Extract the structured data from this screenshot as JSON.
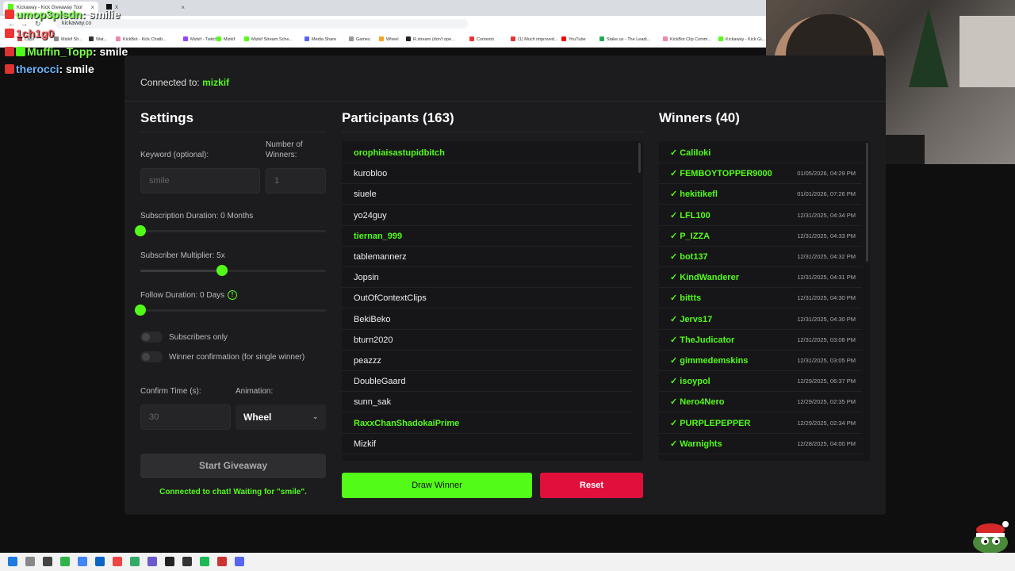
{
  "browser": {
    "tabs": [
      {
        "label": "Kickaway - Kick Giveaway Tool"
      },
      {
        "label": "X"
      }
    ],
    "url": "kickaway.co",
    "bookmarks": [
      "Clips",
      "Mizkif Sh...",
      "Wat...",
      "KickBot - Kick Chatb...",
      "Mizkif - Twitch",
      "Mizkif",
      "Mizkif Stream Sche...",
      "Media Share",
      "Games",
      "Wheel",
      "R.stream (don't ope...",
      "Contexto",
      "(1) Much improved...",
      "YouTube",
      "Stake.us - The Leadi...",
      "KickBot Clip Comm...",
      "Kickaway - Kick Gi..."
    ]
  },
  "chat": [
    {
      "user": "umop3plsdn",
      "message": "smilie"
    },
    {
      "user": "1ch1g0",
      "message": ""
    },
    {
      "user": "Muffin_Topp",
      "message": "smile"
    },
    {
      "user": "therocci",
      "message": "smile"
    }
  ],
  "header": {
    "connected_label": "Connected to:",
    "channel": "mizkif"
  },
  "settings": {
    "title": "Settings",
    "keyword_label": "Keyword (optional):",
    "keyword_value": "smile",
    "winners_label_1": "Number of",
    "winners_label_2": "Winners:",
    "winners_value": "1",
    "sub_duration_label": "Subscription Duration: 0 Months",
    "sub_duration_fraction": 0.0,
    "sub_multiplier_label": "Subscriber Multiplier: 5x",
    "sub_multiplier_fraction": 0.44,
    "follow_label": "Follow Duration: 0 Days",
    "follow_fraction": 0.0,
    "info_glyph": "!",
    "subscribers_only_label": "Subscribers only",
    "winner_confirm_label": "Winner confirmation (for single winner)",
    "confirm_time_label": "Confirm Time (s):",
    "confirm_time_value": "30",
    "animation_label": "Animation:",
    "animation_value": "Wheel",
    "start_button": "Start Giveaway",
    "status": "Connected to chat! Waiting for \"smile\"."
  },
  "participants": {
    "title": "Participants (163)",
    "items": [
      {
        "name": "orophiaisastupidbitch",
        "highlight": true
      },
      {
        "name": "kurobloo",
        "highlight": false
      },
      {
        "name": "siuele",
        "highlight": false
      },
      {
        "name": "yo24guy",
        "highlight": false
      },
      {
        "name": "tiernan_999",
        "highlight": true
      },
      {
        "name": "tablemannerz",
        "highlight": false
      },
      {
        "name": "Jopsin",
        "highlight": false
      },
      {
        "name": "OutOfContextClips",
        "highlight": false
      },
      {
        "name": "BekiBeko",
        "highlight": false
      },
      {
        "name": "bturn2020",
        "highlight": false
      },
      {
        "name": "peazzz",
        "highlight": false
      },
      {
        "name": "DoubleGaard",
        "highlight": false
      },
      {
        "name": "sunn_sak",
        "highlight": false
      },
      {
        "name": "RaxxChanShadokaiPrime",
        "highlight": true
      },
      {
        "name": "Mizkif",
        "highlight": false
      }
    ]
  },
  "winners": {
    "title": "Winners (40)",
    "check": "✓",
    "items": [
      {
        "name": "Caliloki",
        "date": ""
      },
      {
        "name": "FEMBOYTOPPER9000",
        "date": "01/05/2026, 04:29 PM"
      },
      {
        "name": "hekitikefl",
        "date": "01/01/2026, 07:26 PM"
      },
      {
        "name": "LFL100",
        "date": "12/31/2025, 04:34 PM"
      },
      {
        "name": "P_IZZA",
        "date": "12/31/2025, 04:33 PM"
      },
      {
        "name": "bot137",
        "date": "12/31/2025, 04:32 PM"
      },
      {
        "name": "KindWanderer",
        "date": "12/31/2025, 04:31 PM"
      },
      {
        "name": "bittts",
        "date": "12/31/2025, 04:30 PM"
      },
      {
        "name": "Jervs17",
        "date": "12/31/2025, 04:30 PM"
      },
      {
        "name": "TheJudicator",
        "date": "12/31/2025, 03:08 PM"
      },
      {
        "name": "gimmedemskins",
        "date": "12/31/2025, 03:05 PM"
      },
      {
        "name": "isoypol",
        "date": "12/29/2025, 06:37 PM"
      },
      {
        "name": "Nero4Nero",
        "date": "12/29/2025, 02:35 PM"
      },
      {
        "name": "PURPLEPEPPER",
        "date": "12/29/2025, 02:34 PM"
      },
      {
        "name": "Warnights",
        "date": "12/28/2025, 04:00 PM"
      }
    ]
  },
  "actions": {
    "draw": "Draw Winner",
    "reset": "Reset"
  },
  "colors": {
    "accent": "#53fc18",
    "danger": "#e0103a",
    "panel": "#1c1c1e"
  }
}
